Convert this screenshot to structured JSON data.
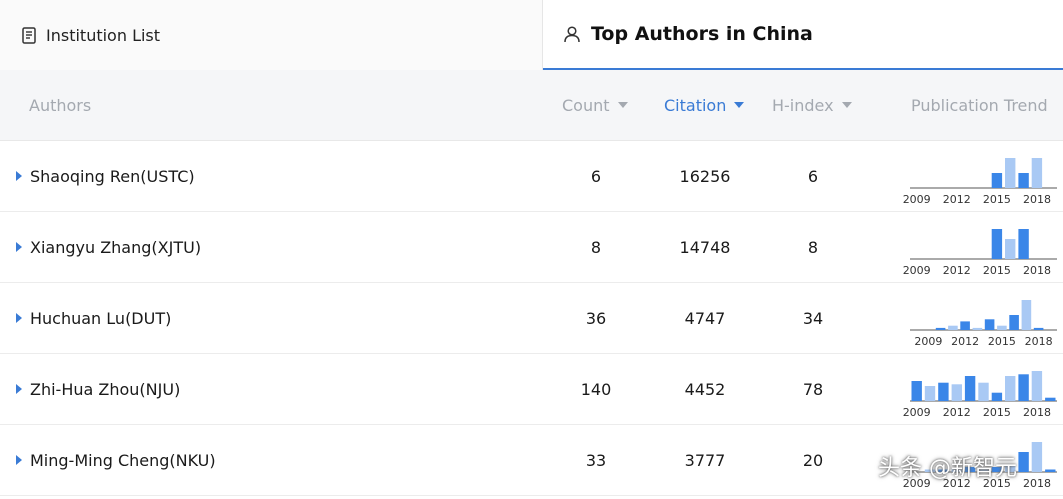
{
  "tabs": {
    "institution": {
      "label": "Institution List",
      "icon": "document-icon"
    },
    "top_authors": {
      "label": "Top Authors in China",
      "icon": "person-icon"
    }
  },
  "columns": {
    "authors": "Authors",
    "count": "Count",
    "citation": "Citation",
    "hindex": "H-index",
    "trend": "Publication Trend"
  },
  "sorted_column": "citation",
  "colors": {
    "accent": "#3a7bd5",
    "bar_dark": "#3a86e8",
    "bar_light": "#a9c9f4",
    "header_text": "#a4a9b0"
  },
  "rows": [
    {
      "name": "Shaoqing Ren",
      "inst": "(USTC)",
      "count": "6",
      "citation": "16256",
      "hindex": "6",
      "trend": {
        "labels": [
          "2009",
          "2012",
          "2015",
          "2018"
        ],
        "years": [
          2009,
          2010,
          2011,
          2012,
          2013,
          2014,
          2015,
          2016,
          2017,
          2018,
          2019
        ],
        "values": [
          0,
          0,
          0,
          0,
          0,
          0,
          1,
          2,
          1,
          2,
          0
        ]
      }
    },
    {
      "name": "Xiangyu Zhang",
      "inst": "(XJTU)",
      "count": "8",
      "citation": "14748",
      "hindex": "8",
      "trend": {
        "labels": [
          "2009",
          "2012",
          "2015",
          "2018"
        ],
        "years": [
          2009,
          2010,
          2011,
          2012,
          2013,
          2014,
          2015,
          2016,
          2017,
          2018,
          2019
        ],
        "values": [
          0,
          0,
          0,
          0,
          0,
          0,
          3,
          2,
          3,
          0,
          0
        ]
      }
    },
    {
      "name": "Huchuan Lu",
      "inst": "(DUT)",
      "count": "36",
      "citation": "4747",
      "hindex": "34",
      "trend": {
        "labels": [
          "2009",
          "2012",
          "2015",
          "2018"
        ],
        "years": [
          2008,
          2009,
          2010,
          2011,
          2012,
          2013,
          2014,
          2015,
          2016,
          2017,
          2018,
          2019
        ],
        "values": [
          0,
          0,
          1,
          2,
          4,
          1,
          5,
          2,
          7,
          14,
          1,
          0
        ]
      }
    },
    {
      "name": "Zhi-Hua Zhou",
      "inst": "(NJU)",
      "count": "140",
      "citation": "4452",
      "hindex": "78",
      "trend": {
        "labels": [
          "2009",
          "2012",
          "2015",
          "2018"
        ],
        "years": [
          2009,
          2010,
          2011,
          2012,
          2013,
          2014,
          2015,
          2016,
          2017,
          2018,
          2019
        ],
        "values": [
          12,
          9,
          11,
          10,
          15,
          11,
          5,
          15,
          16,
          18,
          2
        ]
      }
    },
    {
      "name": "Ming-Ming Cheng",
      "inst": "(NKU)",
      "count": "33",
      "citation": "3777",
      "hindex": "20",
      "trend": {
        "labels": [
          "2009",
          "2012",
          "2015",
          "2018"
        ],
        "years": [
          2009,
          2010,
          2011,
          2012,
          2013,
          2014,
          2015,
          2016,
          2017,
          2018,
          2019
        ],
        "values": [
          0,
          1,
          1,
          1,
          2,
          1,
          2,
          3,
          8,
          12,
          1
        ]
      }
    }
  ],
  "watermark": "头条 @新智元"
}
